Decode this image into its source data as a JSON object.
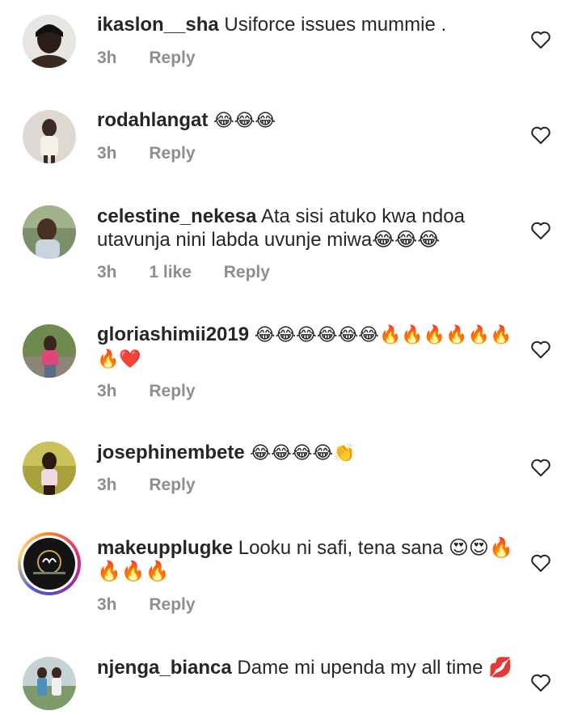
{
  "reply_label": "Reply",
  "comments": [
    {
      "username": "ikaslon__sha",
      "text": "Usiforce issues mummie .",
      "time": "3h",
      "likes": ""
    },
    {
      "username": "rodahlangat",
      "text": "😂😂😂",
      "time": "3h",
      "likes": ""
    },
    {
      "username": "celestine_nekesa",
      "text": "Ata sisi atuko kwa ndoa utavunja nini labda uvunje miwa😂😂😂",
      "time": "3h",
      "likes": "1 like"
    },
    {
      "username": "gloriashimii2019",
      "text": "😂😂😂😂😂😂🔥🔥🔥🔥🔥🔥🔥❤️",
      "time": "3h",
      "likes": ""
    },
    {
      "username": "josephinembete",
      "text": "😂😂😂😂👏",
      "time": "3h",
      "likes": ""
    },
    {
      "username": "makeupplugke",
      "text": "Looku ni safi, tena sana 😍😍🔥🔥🔥🔥",
      "time": "3h",
      "likes": ""
    },
    {
      "username": "njenga_bianca",
      "text": "Dame mi upenda my all time 💋",
      "time": "",
      "likes": ""
    }
  ],
  "icons": {
    "like": "heart-outline-icon"
  },
  "colors": {
    "username": "#262626",
    "meta": "#8e8e8e",
    "heart_stroke": "#262626"
  }
}
